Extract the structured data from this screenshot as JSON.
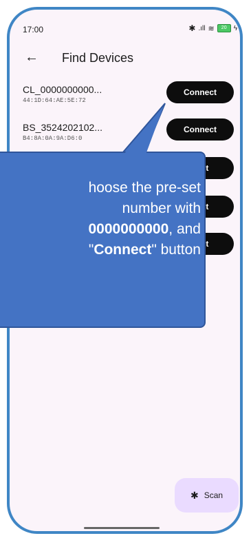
{
  "status": {
    "time": "17:00",
    "battery": "20"
  },
  "header": {
    "title": "Find Devices"
  },
  "devices": [
    {
      "name": "CL_0000000000...",
      "mac": "44:1D:64:AE:5E:72"
    },
    {
      "name": "BS_3524202102...",
      "mac": "B4:8A:0A:9A:D6:0"
    }
  ],
  "buttons": {
    "connect_1": "Connect",
    "connect_2": "Connect",
    "connect_3": "nect",
    "connect_4": "nect",
    "connect_5": "nect"
  },
  "callout": {
    "line1": "hoose the pre-set",
    "line2": "number with",
    "line3_bold": "0000000000",
    "line3_rest": ", and",
    "line4_pre": "\"",
    "line4_bold": "Connect",
    "line4_rest": "\" button"
  },
  "scan": {
    "label": "Scan"
  }
}
